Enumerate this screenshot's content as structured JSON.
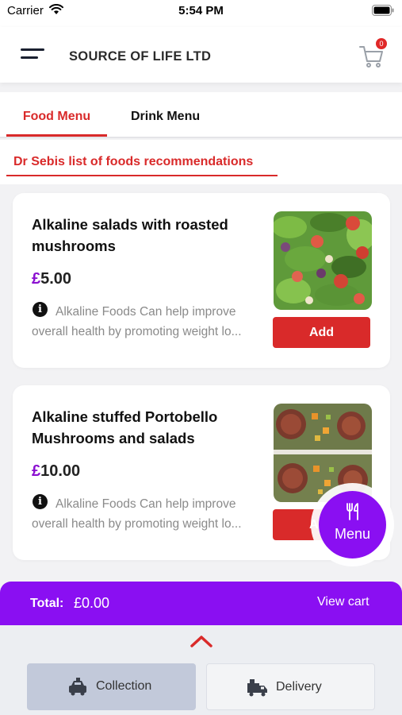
{
  "status_bar": {
    "carrier": "Carrier",
    "time": "5:54 PM"
  },
  "header": {
    "title": "SOURCE OF LIFE LTD",
    "cart_badge": "0"
  },
  "tabs": [
    {
      "label": "Food Menu",
      "active": true
    },
    {
      "label": "Drink Menu",
      "active": false
    }
  ],
  "subheading": "Dr Sebis list of foods recommendations",
  "items": [
    {
      "title": "Alkaline salads with roasted mushrooms",
      "currency": "£",
      "price": "5.00",
      "description": "Alkaline Foods Can help improve overall health by promoting weight lo...",
      "button_label": "Add"
    },
    {
      "title": "Alkaline stuffed Portobello Mushrooms and salads",
      "currency": "£",
      "price": "10.00",
      "description": "Alkaline Foods Can help improve overall health by promoting weight lo...",
      "button_label": "Add"
    }
  ],
  "menu_fab": {
    "label": "Menu"
  },
  "total_bar": {
    "label": "Total:",
    "value": "£0.00",
    "view_cart": "View cart"
  },
  "order_modes": [
    {
      "label": "Collection",
      "selected": true,
      "icon": "collection-icon"
    },
    {
      "label": "Delivery",
      "selected": false,
      "icon": "delivery-icon"
    }
  ],
  "colors": {
    "accent_red": "#d92a2a",
    "accent_purple": "#8a0ff2",
    "background": "#f2f2f4"
  }
}
